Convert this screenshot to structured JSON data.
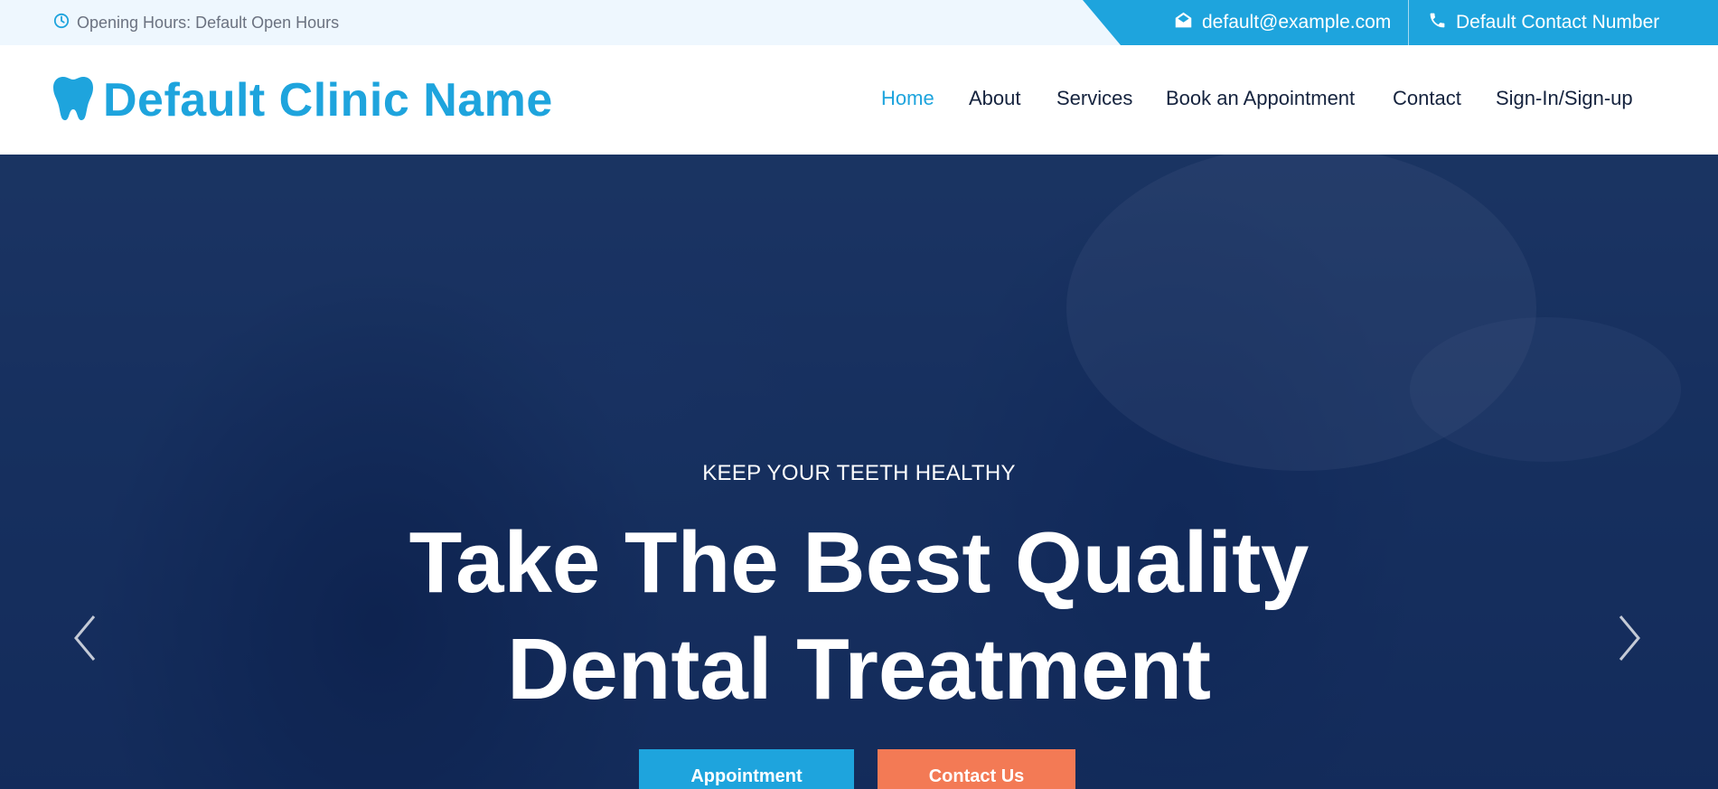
{
  "topbar": {
    "opening_hours": "Opening Hours: Default Open Hours",
    "email": "default@example.com",
    "phone": "Default Contact Number"
  },
  "header": {
    "brand_name": "Default Clinic Name",
    "nav": [
      {
        "label": "Home",
        "active": true
      },
      {
        "label": "About",
        "active": false
      },
      {
        "label": "Services",
        "active": false
      },
      {
        "label": "Book an Appointment",
        "active": false
      },
      {
        "label": "Contact",
        "active": false
      },
      {
        "label": "Sign-In/Sign-up",
        "active": false
      }
    ]
  },
  "hero": {
    "subtitle": "KEEP YOUR TEETH HEALTHY",
    "title_line1": "Take The Best Quality",
    "title_line2": "Dental Treatment",
    "primary_button": "Appointment",
    "secondary_button": "Contact Us"
  },
  "icons": {
    "clock": "clock-icon",
    "email": "envelope-open-icon",
    "phone": "phone-icon",
    "brand": "tooth-icon",
    "prev": "chevron-left-icon",
    "next": "chevron-right-icon"
  },
  "colors": {
    "accent": "#1ea4dd",
    "secondary": "#f37a55",
    "nav_text": "#15233e",
    "topbar_bg": "#eef7fe",
    "hero_overlay": "#0d2252"
  }
}
